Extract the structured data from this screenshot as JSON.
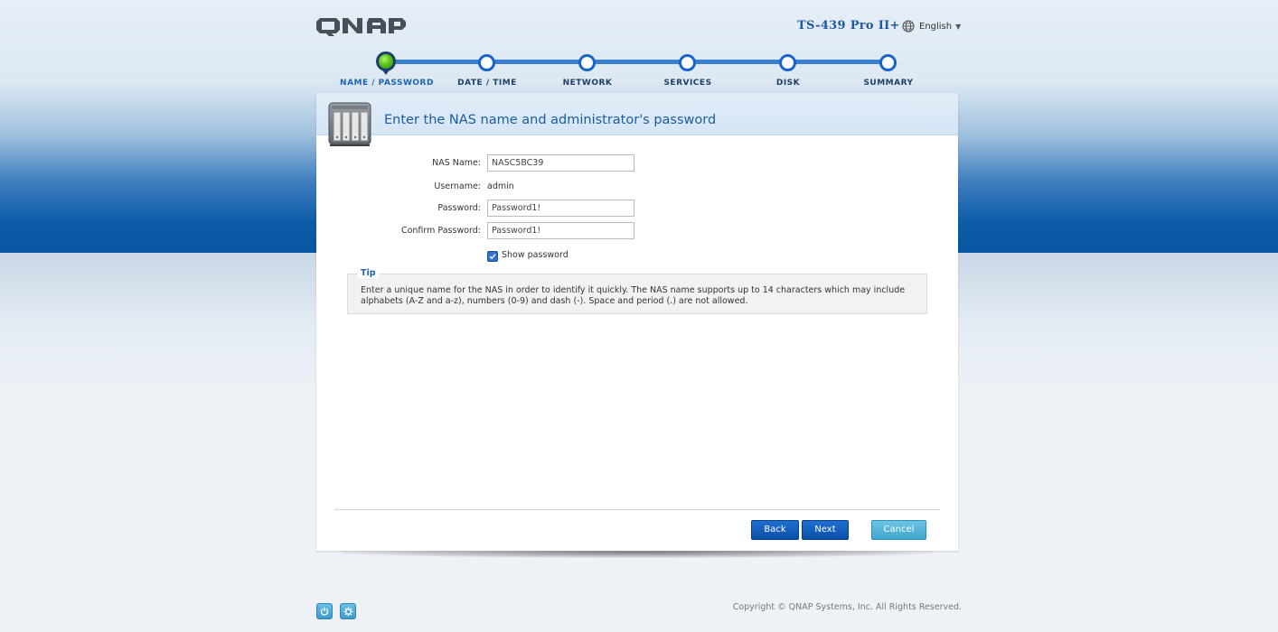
{
  "header": {
    "logo_text": "QNAP",
    "model": "TS-439 Pro II+",
    "language": "English"
  },
  "steps": [
    {
      "label": "NAME / PASSWORD",
      "active": true
    },
    {
      "label": "DATE / TIME",
      "active": false
    },
    {
      "label": "NETWORK",
      "active": false
    },
    {
      "label": "SERVICES",
      "active": false
    },
    {
      "label": "DISK",
      "active": false
    },
    {
      "label": "SUMMARY",
      "active": false
    }
  ],
  "panel": {
    "title": "Enter the NAS name and administrator's password"
  },
  "form": {
    "nas_name_label": "NAS Name:",
    "nas_name_value": "NASC5BC39",
    "username_label": "Username:",
    "username_value": "admin",
    "password_label": "Password:",
    "password_value": "Password1!",
    "confirm_label": "Confirm Password:",
    "confirm_value": "Password1!",
    "show_password_label": "Show password",
    "show_password_checked": true
  },
  "tip": {
    "title": "Tip",
    "text": "Enter a unique name for the NAS in order to identify it quickly. The NAS name supports up to 14 characters which may include alphabets (A-Z and a-z), numbers (0-9) and dash (-). Space and period (.) are not allowed."
  },
  "buttons": {
    "back": "Back",
    "next": "Next",
    "cancel": "Cancel"
  },
  "footer": {
    "copyright": "Copyright © QNAP Systems, Inc. All Rights Reserved.",
    "icons": [
      "power-icon",
      "settings-icon"
    ]
  },
  "colors": {
    "accent": "#1d63b3",
    "step_line": "#3b7fd0",
    "active_step": "#5cc11a",
    "cancel": "#3fa6cf"
  }
}
